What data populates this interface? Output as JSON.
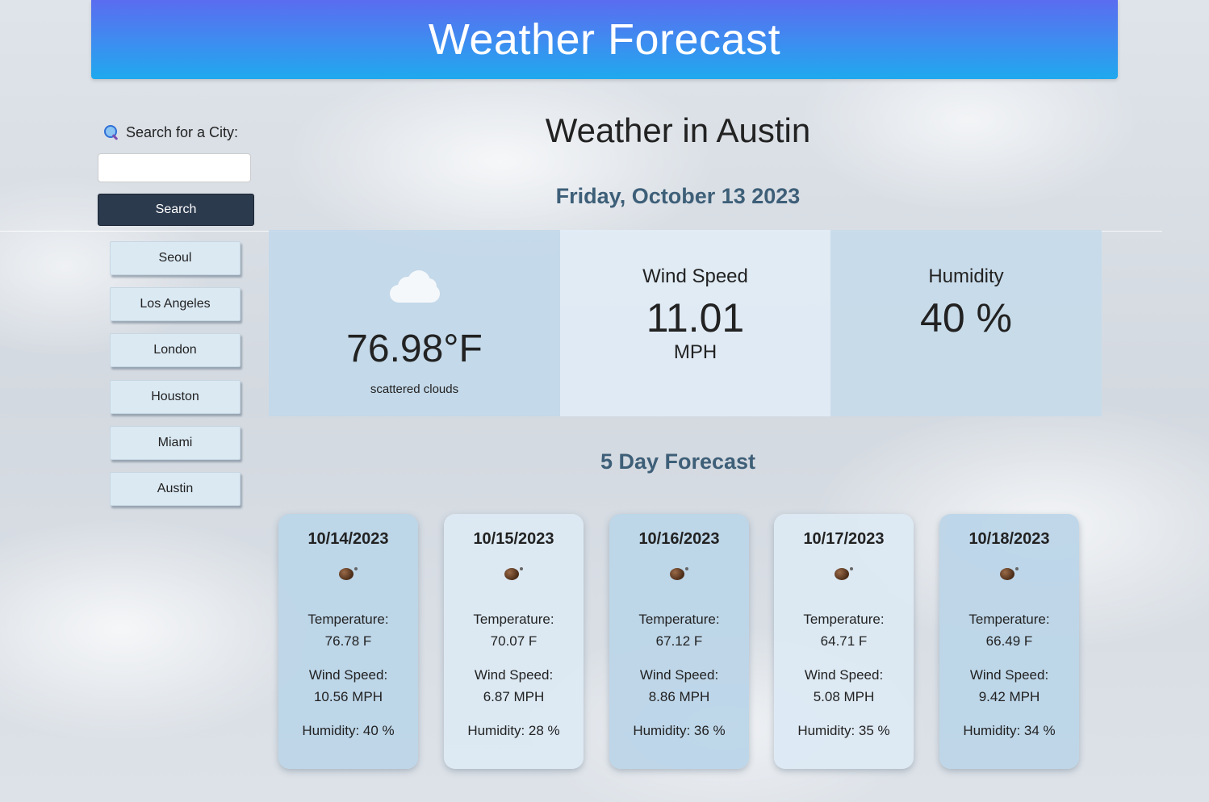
{
  "header": {
    "title": "Weather Forecast"
  },
  "sidebar": {
    "search_label": "Search for a City:",
    "search_value": "",
    "search_placeholder": "",
    "search_button": "Search",
    "cities": [
      "Seoul",
      "Los Angeles",
      "London",
      "Houston",
      "Miami",
      "Austin"
    ]
  },
  "current": {
    "title": "Weather in Austin",
    "date": "Friday, October 13 2023",
    "temperature": "76.98°F",
    "condition": "scattered clouds",
    "condition_icon": "cloud-icon",
    "wind_label": "Wind Speed",
    "wind_value": "11.01",
    "wind_unit": "MPH",
    "humidity_label": "Humidity",
    "humidity_value": "40 %"
  },
  "forecast": {
    "title": "5 Day Forecast",
    "days": [
      {
        "date": "10/14/2023",
        "icon": "weather-icon",
        "temp_label": "Temperature:",
        "temp": "76.78 F",
        "wind_label": "Wind Speed:",
        "wind": "10.56 MPH",
        "humidity": "Humidity: 40 %"
      },
      {
        "date": "10/15/2023",
        "icon": "weather-icon",
        "temp_label": "Temperature:",
        "temp": "70.07 F",
        "wind_label": "Wind Speed:",
        "wind": "6.87 MPH",
        "humidity": "Humidity: 28 %"
      },
      {
        "date": "10/16/2023",
        "icon": "weather-icon",
        "temp_label": "Temperature:",
        "temp": "67.12 F",
        "wind_label": "Wind Speed:",
        "wind": "8.86 MPH",
        "humidity": "Humidity: 36 %"
      },
      {
        "date": "10/17/2023",
        "icon": "weather-icon",
        "temp_label": "Temperature:",
        "temp": "64.71 F",
        "wind_label": "Wind Speed:",
        "wind": "5.08 MPH",
        "humidity": "Humidity: 35 %"
      },
      {
        "date": "10/18/2023",
        "icon": "weather-icon",
        "temp_label": "Temperature:",
        "temp": "66.49 F",
        "wind_label": "Wind Speed:",
        "wind": "9.42 MPH",
        "humidity": "Humidity: 34 %"
      }
    ]
  },
  "colors": {
    "header_top": "#5a6cf0",
    "header_bottom": "#1fa9ee",
    "search_button": "#2c3a4e",
    "heading_accent": "#3e5f78"
  }
}
